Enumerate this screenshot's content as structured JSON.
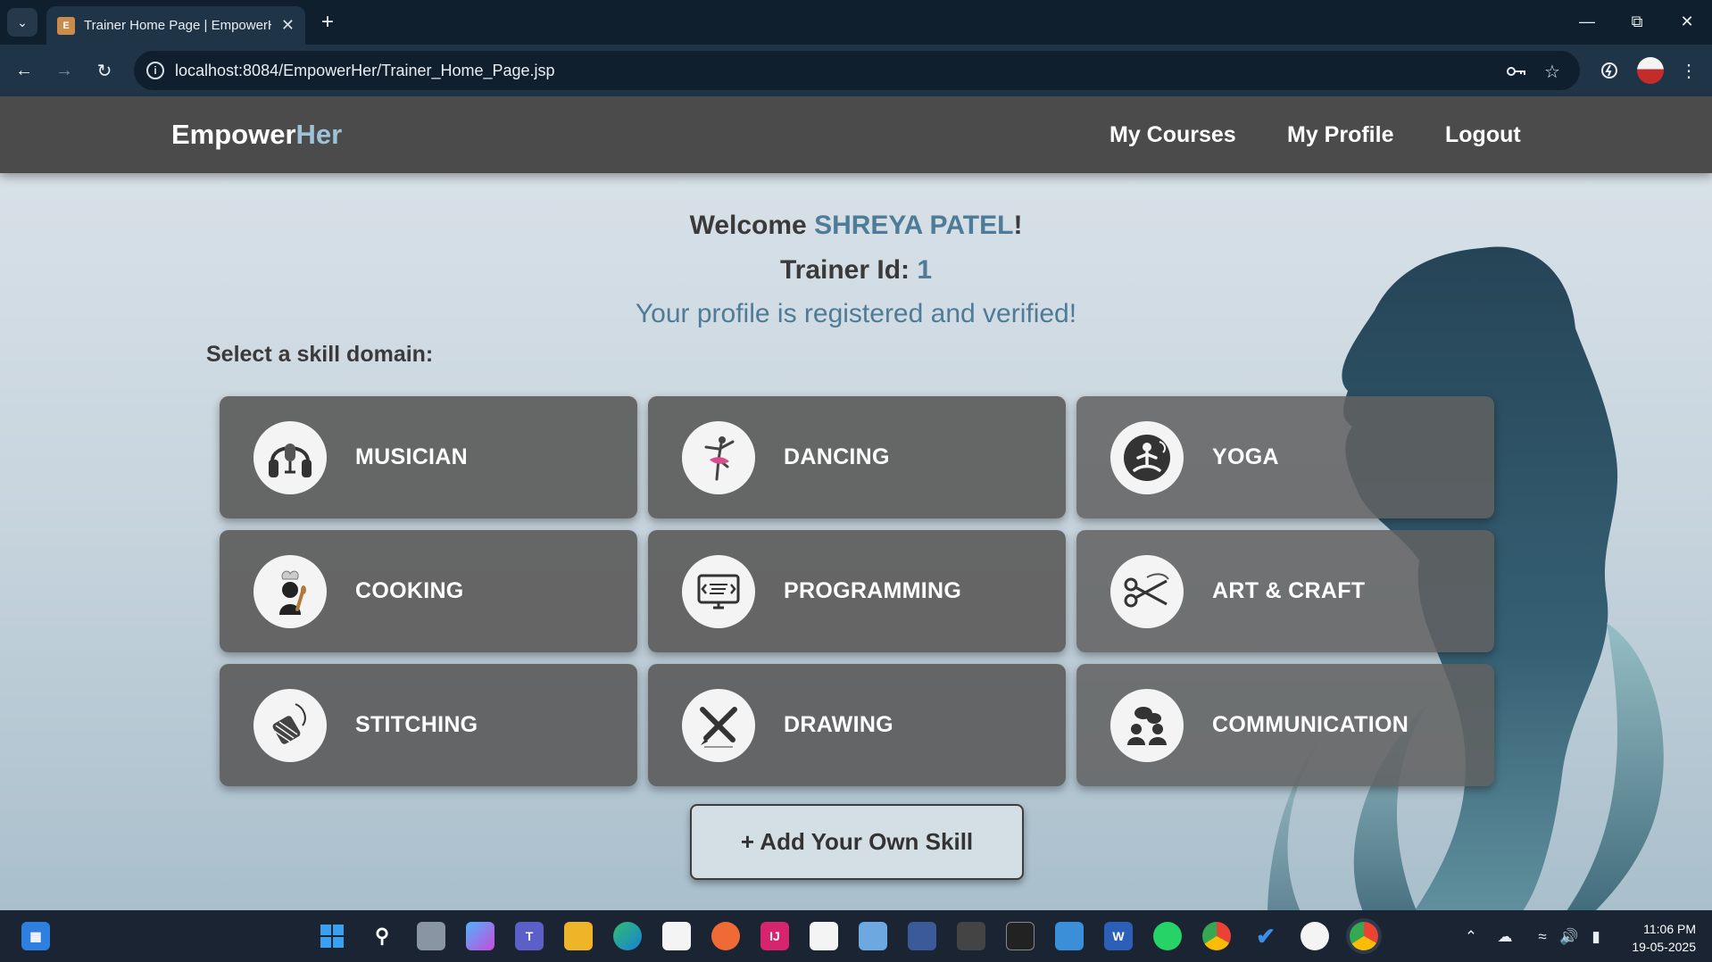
{
  "browser": {
    "tab_title": "Trainer Home Page | EmpowerHer",
    "url": "localhost:8084/EmpowerHer/Trainer_Home_Page.jsp"
  },
  "site": {
    "brand_main": "Empower",
    "brand_accent": "Her",
    "nav": {
      "courses": "My Courses",
      "profile": "My Profile",
      "logout": "Logout"
    }
  },
  "welcome": {
    "greeting": "Welcome ",
    "name": "SHREYA PATEL",
    "exclaim": "!",
    "trainer_label": "Trainer Id: ",
    "trainer_id": "1",
    "status": "Your profile is registered and verified!"
  },
  "skills": {
    "heading": "Select a skill domain:",
    "items": [
      {
        "label": "MUSICIAN",
        "icon": "headphones-microphone-icon"
      },
      {
        "label": "DANCING",
        "icon": "ballerina-icon"
      },
      {
        "label": "YOGA",
        "icon": "meditation-icon"
      },
      {
        "label": "COOKING",
        "icon": "chef-icon"
      },
      {
        "label": "PROGRAMMING",
        "icon": "code-monitor-icon"
      },
      {
        "label": "ART & CRAFT",
        "icon": "scissors-icon"
      },
      {
        "label": "STITCHING",
        "icon": "thread-spool-icon"
      },
      {
        "label": "DRAWING",
        "icon": "pencil-brush-icon"
      },
      {
        "label": "COMMUNICATION",
        "icon": "people-chat-icon"
      }
    ],
    "add_button": "+ Add Your Own Skill"
  },
  "taskbar": {
    "time": "11:06 PM",
    "date": "19-05-2025"
  },
  "colors": {
    "brand_accent": "#9fc3d6",
    "highlight": "#4e7b96",
    "card_bg": "#616161",
    "nav_bg": "#4b4b4b"
  }
}
